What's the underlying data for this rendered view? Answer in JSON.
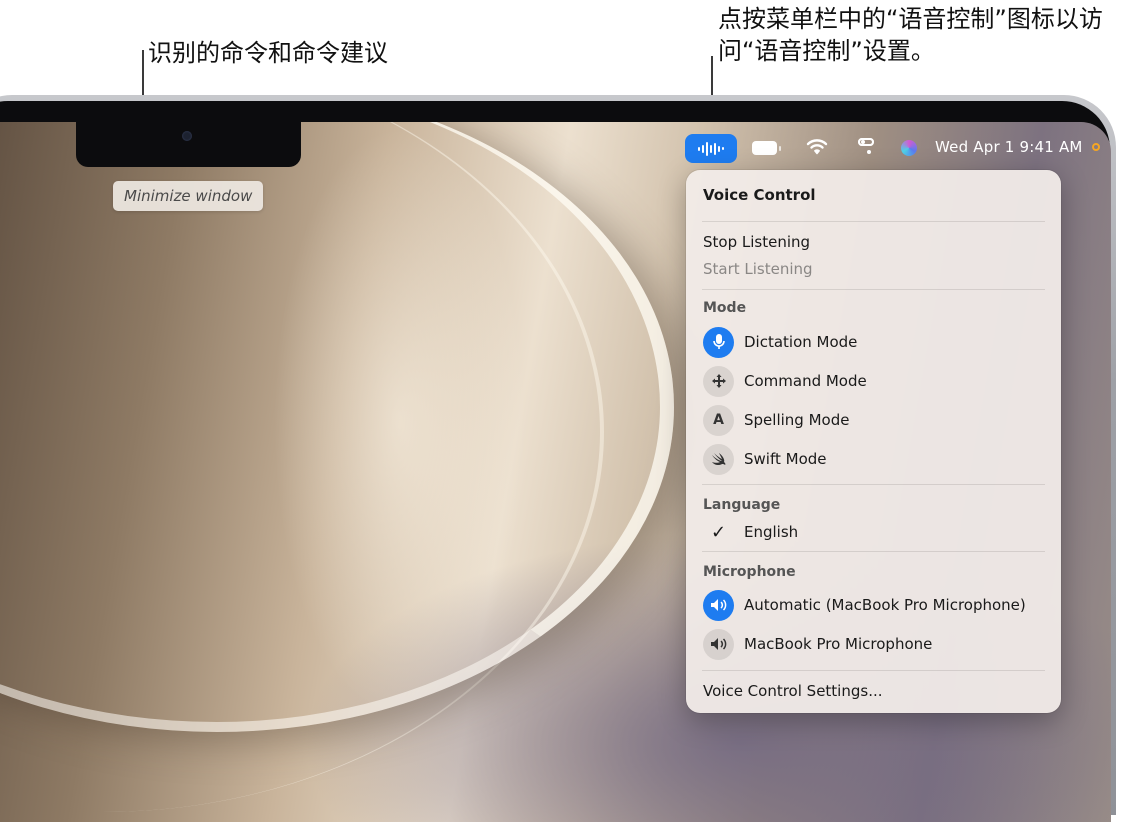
{
  "callouts": {
    "left": "识别的命令和命令建议",
    "right": "点按菜单栏中的“语音控制”图标以访问“语音控制”设置。"
  },
  "command_suggestion": "Minimize window",
  "menubar": {
    "voice_control_icon": "voice-control-waveform-icon",
    "battery_icon": "battery-icon",
    "wifi_icon": "wifi-icon",
    "control_center_icon": "control-center-icon",
    "siri_icon": "siri-icon",
    "clock": "Wed Apr 1  9:41 AM",
    "accent": "#1e7cf0",
    "recording_indicator_color": "#f5a623"
  },
  "menu": {
    "title": "Voice Control",
    "stop_listening": "Stop Listening",
    "start_listening": "Start Listening",
    "mode_header": "Mode",
    "modes": [
      {
        "label": "Dictation Mode",
        "icon": "microphone-icon",
        "selected": true
      },
      {
        "label": "Command Mode",
        "icon": "move-arrows-icon",
        "selected": false
      },
      {
        "label": "Spelling Mode",
        "icon": "letter-a-icon",
        "selected": false
      },
      {
        "label": "Swift Mode",
        "icon": "swift-icon",
        "selected": false
      }
    ],
    "language_header": "Language",
    "language": {
      "label": "English",
      "checked": true
    },
    "microphone_header": "Microphone",
    "microphones": [
      {
        "label": "Automatic (MacBook Pro Microphone)",
        "icon": "speaker-icon",
        "selected": true
      },
      {
        "label": "MacBook Pro Microphone",
        "icon": "speaker-icon",
        "selected": false
      }
    ],
    "settings": "Voice Control Settings..."
  }
}
